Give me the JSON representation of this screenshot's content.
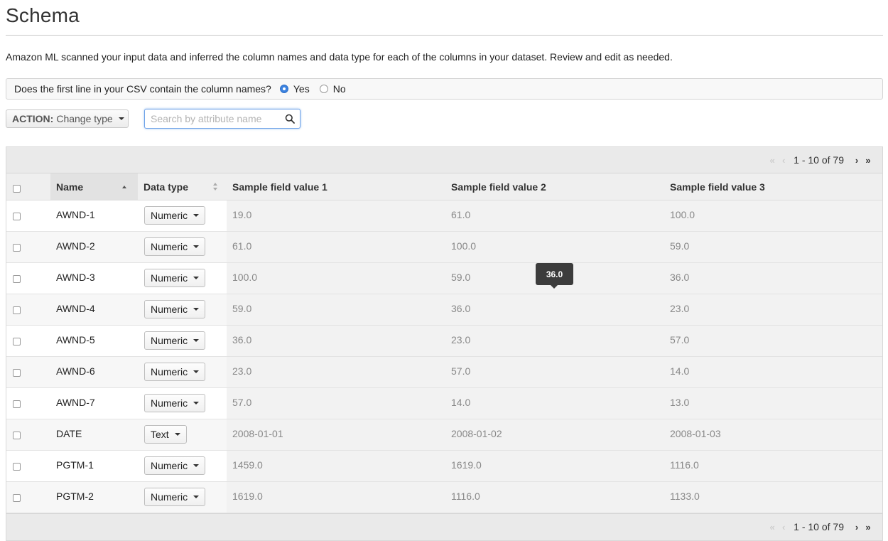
{
  "page": {
    "title": "Schema",
    "description": "Amazon ML scanned your input data and inferred the column names and data type for each of the columns in your dataset. Review and edit as needed."
  },
  "header_question": {
    "text": "Does the first line in your CSV contain the column names?",
    "options": [
      {
        "label": "Yes",
        "selected": true
      },
      {
        "label": "No",
        "selected": false
      }
    ]
  },
  "toolbar": {
    "action_label": "ACTION:",
    "action_value": "Change type",
    "search_placeholder": "Search by attribute name"
  },
  "pager": {
    "range_text": "1 - 10 of 79"
  },
  "table": {
    "columns": [
      "Name",
      "Data type",
      "Sample field value 1",
      "Sample field value 2",
      "Sample field value 3"
    ],
    "rows": [
      {
        "name": "AWND-1",
        "type": "Numeric",
        "v1": "19.0",
        "v2": "61.0",
        "v3": "100.0"
      },
      {
        "name": "AWND-2",
        "type": "Numeric",
        "v1": "61.0",
        "v2": "100.0",
        "v3": "59.0"
      },
      {
        "name": "AWND-3",
        "type": "Numeric",
        "v1": "100.0",
        "v2": "59.0",
        "v3": "36.0"
      },
      {
        "name": "AWND-4",
        "type": "Numeric",
        "v1": "59.0",
        "v2": "36.0",
        "v3": "23.0"
      },
      {
        "name": "AWND-5",
        "type": "Numeric",
        "v1": "36.0",
        "v2": "23.0",
        "v3": "57.0"
      },
      {
        "name": "AWND-6",
        "type": "Numeric",
        "v1": "23.0",
        "v2": "57.0",
        "v3": "14.0"
      },
      {
        "name": "AWND-7",
        "type": "Numeric",
        "v1": "57.0",
        "v2": "14.0",
        "v3": "13.0"
      },
      {
        "name": "DATE",
        "type": "Text",
        "v1": "2008-01-01",
        "v2": "2008-01-02",
        "v3": "2008-01-03"
      },
      {
        "name": "PGTM-1",
        "type": "Numeric",
        "v1": "1459.0",
        "v2": "1619.0",
        "v3": "1116.0"
      },
      {
        "name": "PGTM-2",
        "type": "Numeric",
        "v1": "1619.0",
        "v2": "1116.0",
        "v3": "1133.0"
      }
    ]
  },
  "tooltip": {
    "text": "36.0"
  },
  "colors": {
    "accent": "#3b82e0",
    "tooltip_bg": "#3c3c3c"
  }
}
